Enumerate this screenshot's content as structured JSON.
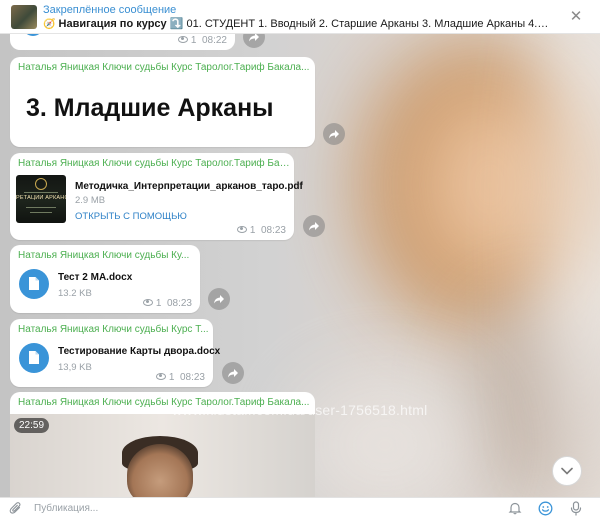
{
  "pinned": {
    "title": "Закреплённое сообщение",
    "bold_text": "Навигация по курсу",
    "arrow": "⤵️",
    "text": "01. СТУДЕНТ 1. Вводный 2. Старшие Арканы 3. Младшие Арканы 4. Расклады 5. Пр..."
  },
  "top_meta": {
    "views": "1",
    "time": "08:22"
  },
  "messages": [
    {
      "sender": "Наталья Яницкая Ключи судьбы Курс Таролог.Тариф Бакала...",
      "title": "3. Младшие Арканы"
    },
    {
      "sender": "Наталья Яницкая Ключи судьбы Курс Таролог.Тариф Бакала...",
      "file_name": "Методичка_Интерпретации_арканов_таро.pdf",
      "file_size": "2.9 MB",
      "action": "ОТКРЫТЬ С ПОМОЩЬЮ",
      "thumb_caption": "РЕТАЦИИ АРКАНОВ",
      "views": "1",
      "time": "08:23"
    },
    {
      "sender": "Наталья Яницкая Ключи судьбы Ку...",
      "file_name": "Тест 2 МА.docx",
      "file_size": "13.2 KB",
      "views": "1",
      "time": "08:23"
    },
    {
      "sender": "Наталья Яницкая Ключи судьбы Курс Т...",
      "file_name": "Тестирование Карты двора.docx",
      "file_size": "13,9 KB",
      "views": "1",
      "time": "08:23"
    },
    {
      "sender": "Наталья Яницкая Ключи судьбы Курс Таролог.Тариф Бакала...",
      "duration": "22:59"
    }
  ],
  "watermark": "www.kidstaff.com.ua/user-1756518.html",
  "composer": {
    "placeholder": "Публикация..."
  },
  "colors": {
    "accent": "#3a94d8",
    "sender": "#4caf50",
    "link": "#2f82c7"
  }
}
